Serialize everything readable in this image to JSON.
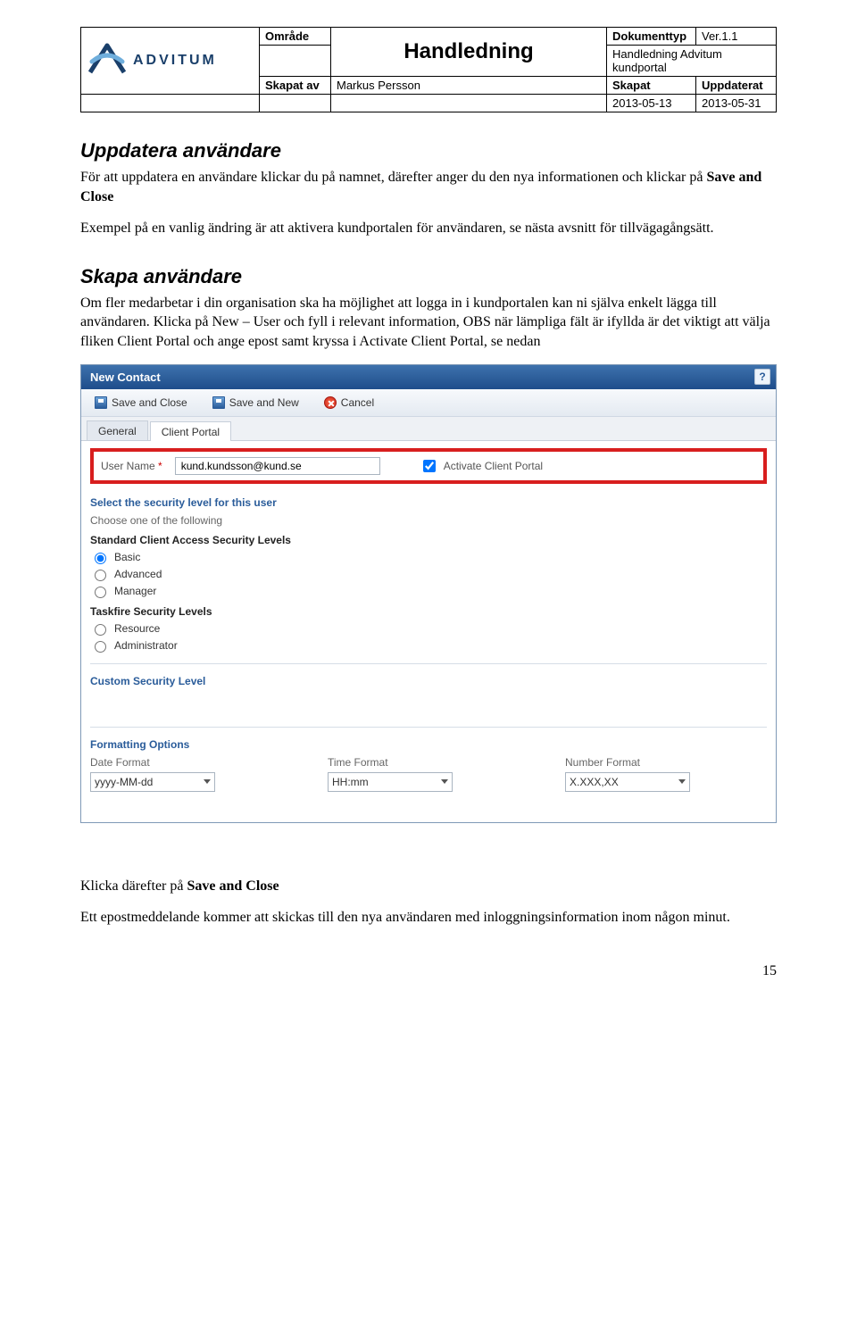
{
  "header": {
    "labels": {
      "omrade": "Område",
      "dokumenttyp": "Dokumenttyp",
      "skapat_av": "Skapat av",
      "skapat": "Skapat",
      "uppdaterat": "Uppdaterat"
    },
    "title": "Handledning",
    "version": "Ver.1.1",
    "doc_name": "Handledning Advitum kundportal",
    "author": "Markus Persson",
    "created": "2013-05-13",
    "updated": "2013-05-31",
    "logo_text": "ADVITUM"
  },
  "sections": {
    "s1_title": "Uppdatera användare",
    "s1_p1_a": "För att uppdatera en användare klickar du på namnet, därefter anger du den nya informationen och klickar på ",
    "s1_p1_b": "Save and Close",
    "s1_p2": "Exempel på en vanlig ändring är att aktivera kundportalen för användaren, se nästa avsnitt för tillvägagångsätt.",
    "s2_title": "Skapa användare",
    "s2_p1": "Om fler medarbetar i din organisation ska ha möjlighet att logga in i kundportalen kan ni själva enkelt lägga till användaren. Klicka på New – User och fyll i relevant information, OBS när lämpliga fält är ifyllda är det viktigt att välja fliken Client Portal och ange epost samt kryssa i Activate Client Portal, se nedan",
    "after1_a": "Klicka därefter på ",
    "after1_b": "Save and Close",
    "after2": "Ett epostmeddelande kommer att skickas till den nya användaren med inloggningsinformation inom någon minut."
  },
  "screenshot": {
    "window_title": "New Contact",
    "help_icon": "?",
    "toolbar": {
      "save_close": "Save and Close",
      "save_new": "Save and New",
      "cancel": "Cancel"
    },
    "tabs": {
      "general": "General",
      "client_portal": "Client Portal"
    },
    "username_label": "User Name",
    "username_value": "kund.kundsson@kund.se",
    "activate_label": "Activate Client Portal",
    "activate_checked": true,
    "sec_title": "Select the security level for this user",
    "choose_one": "Choose one of the following",
    "std_head": "Standard Client Access Security Levels",
    "radios_std": [
      "Basic",
      "Advanced",
      "Manager"
    ],
    "std_selected": "Basic",
    "tf_head": "Taskfire Security Levels",
    "radios_tf": [
      "Resource",
      "Administrator"
    ],
    "custom_title": "Custom Security Level",
    "fmt_title": "Formatting Options",
    "date_label": "Date Format",
    "date_value": "yyyy-MM-dd",
    "time_label": "Time Format",
    "time_value": "HH:mm",
    "num_label": "Number Format",
    "num_value": "X.XXX,XX"
  },
  "page_number": "15"
}
